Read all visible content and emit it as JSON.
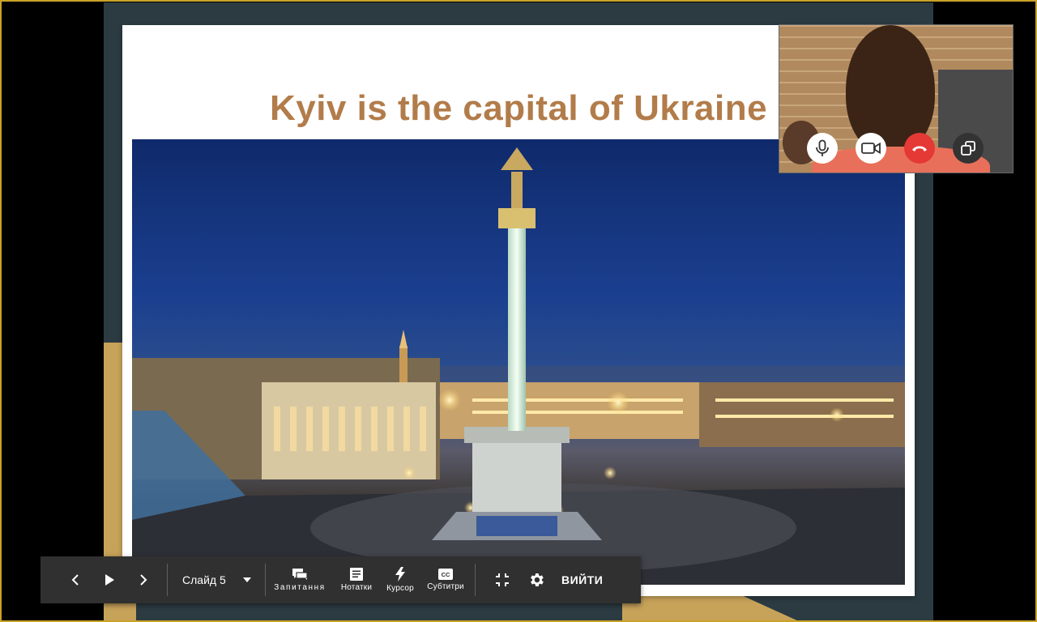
{
  "slide": {
    "title": "Kyiv is the capital of Ukraine",
    "photo_alt": "Independence Square, Kyiv at night"
  },
  "video_call": {
    "controls": [
      {
        "name": "microphone",
        "icon": "microphone-icon"
      },
      {
        "name": "camera",
        "icon": "video-camera-icon"
      },
      {
        "name": "end-call",
        "icon": "phone-hangup-icon",
        "color": "#e53935"
      },
      {
        "name": "pop-out",
        "icon": "pop-out-icon"
      }
    ]
  },
  "toolbar": {
    "prev_icon": "chevron-left-icon",
    "play_icon": "play-icon",
    "next_icon": "chevron-right-icon",
    "slide_selector": "Слайд 5",
    "questions_label": "Запитання",
    "notes_label": "Нотатки",
    "pointer_label": "Курсор",
    "captions_label": "Субтитри",
    "exit_label": "ВИЙТИ"
  },
  "colors": {
    "title": "#b27c4a",
    "slide_teal": "#2b3b41",
    "slide_gold": "#c7a35a",
    "toolbar_bg": "#303030",
    "frame_border": "#c9a227"
  }
}
